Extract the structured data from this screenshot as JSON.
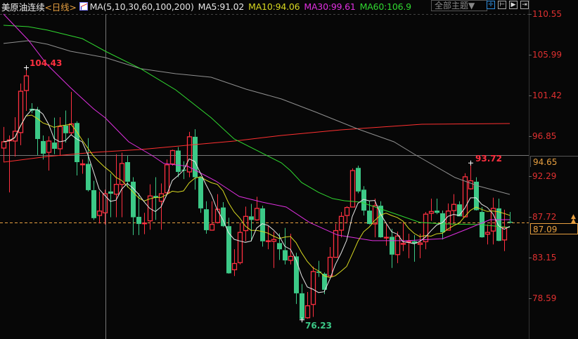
{
  "header": {
    "title": "美原油连续",
    "period": "<日线>",
    "ma_icon": "ma-indicator-icon",
    "ma_def": "MA(5,10,30,60,100,200)",
    "ma5": "MA5:91.02",
    "ma10": "MA10:94.06",
    "ma30": "MA30:99.61",
    "ma60": "MA60:106.9"
  },
  "toolbar": {
    "theme_select": "全部主题▼",
    "buttons": [
      {
        "icon": "crosshair-icon",
        "glyph": "✛"
      },
      {
        "icon": "fit-range-icon",
        "glyph": "⊢"
      },
      {
        "icon": "play-forward-icon",
        "glyph": "▶"
      },
      {
        "icon": "move-right-icon",
        "glyph": "⇥"
      }
    ]
  },
  "colors": {
    "up": "#ff3040",
    "down": "#3cc987",
    "ma5": "#e6e6e6",
    "ma10": "#d8d820",
    "ma30": "#e030e0",
    "ma60": "#30d830",
    "ma100": "#909090",
    "ma200": "#ff3030",
    "current": "#e8a040"
  },
  "axis": {
    "ticks": [
      "110.55",
      "105.99",
      "101.42",
      "96.85",
      "92.29",
      "87.72",
      "83.15",
      "78.59"
    ],
    "crosshair_value": "94.65",
    "current_value": "87.09"
  },
  "annotations": {
    "high": "104.43",
    "low": "76.23",
    "recent_high": "93.72"
  },
  "chart_data": {
    "type": "candlestick",
    "ylim": [
      78.59,
      110.55
    ],
    "current_price": 87.09,
    "crosshair": {
      "index": 18.1,
      "price": 94.65
    },
    "ohlc": [
      [
        95.48,
        96.19,
        97.85,
        93.9
      ],
      [
        96.3,
        96.4,
        96.9,
        90.5
      ],
      [
        96.27,
        97.37,
        98.95,
        94.53
      ],
      [
        97.22,
        101.87,
        102.74,
        95.8
      ],
      [
        101.95,
        103.6,
        104.43,
        99.66
      ],
      [
        99.9,
        99.7,
        100.53,
        99.4
      ],
      [
        99.8,
        96.5,
        100.1,
        94.7
      ],
      [
        96.27,
        94.85,
        96.9,
        94.2
      ],
      [
        95.0,
        96.27,
        96.8,
        92.95
      ],
      [
        96.1,
        95.4,
        98.9,
        94.8
      ],
      [
        95.4,
        97.9,
        98.95,
        94.6
      ],
      [
        98.0,
        97.15,
        99.7,
        96.1
      ],
      [
        97.2,
        98.2,
        101.8,
        96.9
      ],
      [
        98.3,
        93.9,
        98.5,
        92.4
      ],
      [
        93.6,
        93.7,
        94.2,
        92.6
      ],
      [
        93.7,
        90.75,
        96.6,
        90.6
      ],
      [
        90.75,
        87.6,
        91.8,
        87.4
      ],
      [
        87.9,
        88.4,
        90.6,
        87.0
      ],
      [
        88.2,
        90.35,
        90.8,
        86.9
      ],
      [
        90.6,
        90.35,
        92.6,
        87.7
      ],
      [
        90.3,
        91.4,
        94.8,
        87.7
      ],
      [
        91.4,
        93.75,
        94.95,
        87.7
      ],
      [
        93.9,
        91.7,
        94.6,
        91.05
      ],
      [
        91.7,
        87.7,
        92.2,
        85.7
      ],
      [
        87.75,
        86.95,
        90.4,
        85.7
      ],
      [
        87.0,
        87.05,
        88.2,
        85.8
      ],
      [
        87.3,
        90.1,
        91.4,
        86.3
      ],
      [
        90.1,
        89.9,
        92.2,
        87.4
      ],
      [
        89.5,
        90.35,
        91.5,
        86.3
      ],
      [
        90.45,
        93.6,
        94.2,
        90.3
      ],
      [
        93.7,
        95.2,
        95.3,
        93.5
      ],
      [
        95.2,
        92.8,
        95.6,
        92.2
      ],
      [
        93.05,
        92.95,
        94.0,
        92.0
      ],
      [
        92.8,
        96.75,
        97.3,
        92.2
      ],
      [
        96.75,
        92.2,
        97.6,
        90.8
      ],
      [
        92.2,
        88.7,
        92.3,
        88.2
      ],
      [
        88.6,
        86.25,
        89.5,
        85.85
      ],
      [
        86.25,
        86.9,
        89.5,
        86.2
      ],
      [
        87.1,
        88.6,
        90.3,
        87.0
      ],
      [
        88.8,
        86.7,
        89.4,
        86.6
      ],
      [
        86.7,
        81.4,
        87.65,
        81.35
      ],
      [
        81.8,
        82.5,
        84.1,
        81.1
      ],
      [
        82.6,
        86.0,
        87.1,
        82.4
      ],
      [
        86.2,
        87.8,
        88.9,
        85.0
      ],
      [
        87.8,
        87.4,
        89.2,
        85.0
      ],
      [
        87.4,
        88.7,
        90.0,
        87.3
      ],
      [
        88.7,
        85.0,
        89.0,
        84.4
      ],
      [
        85.0,
        85.05,
        86.7,
        84.1
      ],
      [
        85.0,
        85.2,
        86.1,
        82.0
      ],
      [
        84.8,
        84.1,
        85.9,
        82.9
      ],
      [
        84.0,
        82.85,
        86.5,
        82.4
      ],
      [
        82.85,
        83.3,
        85.85,
        82.4
      ],
      [
        83.3,
        79.15,
        83.7,
        77.95
      ],
      [
        79.15,
        76.25,
        80.2,
        76.23
      ],
      [
        76.4,
        77.75,
        79.3,
        76.3
      ],
      [
        77.9,
        81.6,
        82.15,
        76.5
      ],
      [
        81.6,
        81.45,
        82.8,
        81.0
      ],
      [
        81.35,
        79.55,
        81.5,
        79.05
      ],
      [
        81.1,
        83.2,
        84.35,
        81.1
      ],
      [
        83.2,
        86.2,
        86.95,
        83.2
      ],
      [
        86.25,
        87.8,
        88.3,
        85.45
      ],
      [
        87.9,
        88.8,
        88.95,
        87.0
      ],
      [
        88.85,
        92.95,
        93.2,
        88.85
      ],
      [
        93.25,
        90.6,
        93.5,
        90.4
      ],
      [
        90.8,
        88.45,
        91.2,
        87.9
      ],
      [
        88.45,
        86.95,
        89.5,
        86.9
      ],
      [
        86.95,
        89.0,
        89.8,
        85.45
      ],
      [
        89.0,
        85.45,
        89.5,
        85.4
      ],
      [
        85.4,
        85.45,
        86.9,
        84.5
      ],
      [
        85.5,
        83.5,
        86.4,
        82.0
      ],
      [
        83.5,
        85.6,
        86.1,
        82.55
      ],
      [
        84.7,
        84.75,
        87.1,
        83.9
      ],
      [
        84.9,
        85.0,
        85.85,
        83.1
      ],
      [
        85.0,
        84.75,
        85.7,
        82.7
      ],
      [
        84.65,
        84.8,
        85.85,
        83.1
      ],
      [
        84.95,
        88.05,
        88.3,
        84.1
      ],
      [
        88.15,
        88.35,
        89.8,
        87.3
      ],
      [
        88.45,
        88.2,
        89.8,
        88.05
      ],
      [
        88.15,
        86.0,
        88.45,
        85.2
      ],
      [
        86.25,
        88.4,
        89.25,
        86.25
      ],
      [
        88.45,
        89.15,
        90.3,
        86.95
      ],
      [
        89.15,
        87.8,
        89.5,
        87.8
      ],
      [
        87.75,
        92.25,
        92.65,
        87.75
      ],
      [
        90.9,
        91.8,
        93.72,
        90.8
      ],
      [
        91.7,
        88.5,
        92.2,
        88.45
      ],
      [
        88.3,
        85.45,
        88.85,
        85.4
      ],
      [
        85.8,
        86.0,
        86.9,
        84.65
      ],
      [
        86.15,
        88.7,
        89.9,
        84.65
      ],
      [
        88.7,
        85.05,
        89.8,
        85.0
      ],
      [
        85.15,
        86.55,
        88.55,
        83.9
      ],
      [
        87.2,
        87.09,
        88.3,
        87.0
      ]
    ],
    "ma_lines": {
      "ma30": [
        [
          0,
          110.55
        ],
        [
          4.4,
          107.63
        ],
        [
          7.75,
          104.87
        ],
        [
          11.9,
          102.27
        ],
        [
          16,
          99.9
        ],
        [
          18.1,
          98.87
        ],
        [
          22.25,
          96.19
        ],
        [
          26.5,
          94.61
        ],
        [
          28.5,
          93.75
        ],
        [
          30.6,
          93.59
        ],
        [
          32.75,
          93.43
        ],
        [
          37.75,
          91.77
        ],
        [
          41.9,
          90.04
        ],
        [
          46,
          89.4
        ],
        [
          50.25,
          88.85
        ],
        [
          54.4,
          87.12
        ],
        [
          59.4,
          85.7
        ],
        [
          65.6,
          85.07
        ],
        [
          71.9,
          85.07
        ],
        [
          78.1,
          85.3
        ],
        [
          82.25,
          86.33
        ],
        [
          86.5,
          87.43
        ],
        [
          90,
          87.43
        ]
      ],
      "ma60": [
        [
          0,
          109.29
        ],
        [
          4.4,
          109.13
        ],
        [
          7.8,
          108.74
        ],
        [
          14,
          107.79
        ],
        [
          18.1,
          106.37
        ],
        [
          24.4,
          104.4
        ],
        [
          30.6,
          102.03
        ],
        [
          36.9,
          98.9
        ],
        [
          41,
          96.5
        ],
        [
          49.4,
          93.82
        ],
        [
          51,
          92.95
        ],
        [
          53,
          91.6
        ],
        [
          56,
          90.5
        ],
        [
          58.5,
          89.8
        ],
        [
          60.6,
          89.56
        ],
        [
          63.5,
          89.4
        ],
        [
          69.75,
          88.06
        ],
        [
          74,
          87.12
        ],
        [
          78.1,
          86.96
        ],
        [
          84.4,
          86.88
        ],
        [
          90,
          86.56
        ]
      ],
      "ma100": [
        [
          0,
          107.24
        ],
        [
          4.4,
          107.55
        ],
        [
          7.8,
          107.16
        ],
        [
          11.9,
          106.37
        ],
        [
          18.1,
          105.66
        ],
        [
          24.4,
          104.4
        ],
        [
          30.6,
          103.84
        ],
        [
          36.9,
          103.45
        ],
        [
          43.1,
          102.11
        ],
        [
          49.4,
          101.0
        ],
        [
          55.6,
          99.5
        ],
        [
          63.1,
          97.6
        ],
        [
          69.4,
          96.19
        ],
        [
          73.1,
          94.77
        ],
        [
          80.25,
          92.17
        ],
        [
          84.4,
          91.22
        ],
        [
          90,
          90.27
        ]
      ],
      "ma200": [
        [
          0,
          93.9
        ],
        [
          7.8,
          94.53
        ],
        [
          16,
          95.0
        ],
        [
          24.4,
          95.32
        ],
        [
          32.75,
          95.8
        ],
        [
          41,
          96.27
        ],
        [
          49.4,
          96.9
        ],
        [
          60,
          97.53
        ],
        [
          74.4,
          98.16
        ],
        [
          90,
          98.24
        ]
      ]
    }
  }
}
